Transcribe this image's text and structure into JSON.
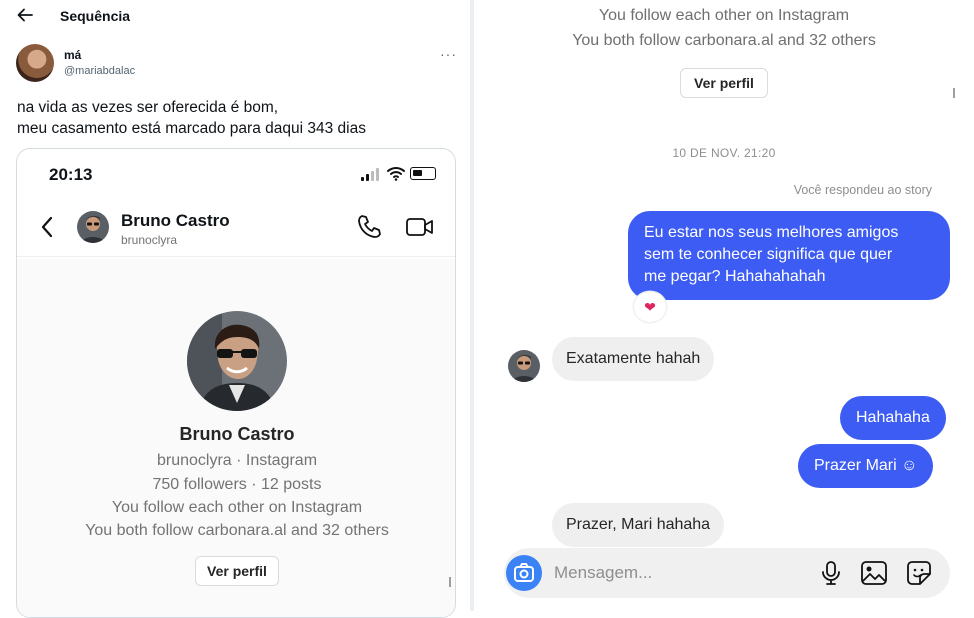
{
  "topbar": {
    "back_icon": "arrow-left-icon",
    "title": "Sequência"
  },
  "tweet": {
    "author_name": "má",
    "author_handle": "@mariabdalac",
    "more_icon": "more-horizontal-icon",
    "lines": [
      "na vida as vezes ser oferecida é bom,",
      "meu casamento está marcado para daqui 343 dias"
    ]
  },
  "phone": {
    "status_time": "20:13",
    "header": {
      "name": "Bruno Castro",
      "handle": "brunoclyra"
    },
    "profile": {
      "name": "Bruno Castro",
      "subtitle": "brunoclyra · Instagram",
      "stats": "750 followers · 12 posts",
      "mutual": "You follow each other on Instagram",
      "also_follow": "You both follow carbonara.al and 32 others",
      "button": "Ver perfil"
    }
  },
  "chat": {
    "mutual": "You follow each other on Instagram",
    "also_follow": "You both follow carbonara.al and 32 others",
    "button": "Ver perfil",
    "timestamp": "10 DE NOV. 21:20",
    "replied_label": "Você respondeu ao story",
    "messages": {
      "m1_lines": [
        "Eu estar nos seus melhores amigos",
        "sem te conhecer significa que quer",
        "me pegar? Hahahahahah"
      ],
      "m1_reaction": "❤",
      "m2": "Exatamente hahah",
      "m3": "Hahahaha",
      "m4": "Prazer Mari ☺",
      "m5": "Prazer, Mari hahaha"
    },
    "composer_placeholder": "Mensagem..."
  },
  "colors": {
    "outgoing_bubble": "#3d5cf3",
    "incoming_bubble": "#efefef",
    "camera_button": "#3b82f6"
  }
}
